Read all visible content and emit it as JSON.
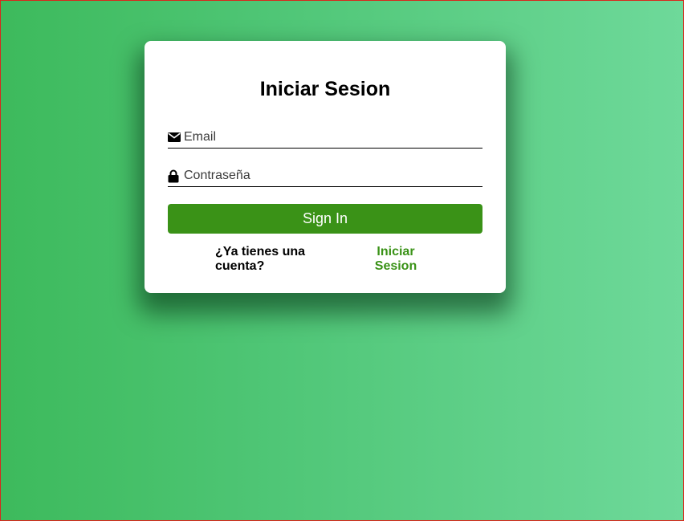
{
  "login": {
    "title": "Iniciar Sesion",
    "email_placeholder": "Email",
    "password_placeholder": "Contraseña",
    "submit_label": "Sign In",
    "account_prompt": "¿Ya tienes una cuenta?",
    "login_link_label": "Iniciar Sesion"
  },
  "icons": {
    "email": "envelope-icon",
    "password": "lock-icon"
  },
  "colors": {
    "accent": "#3a9217",
    "background_start": "#3dba5c",
    "background_end": "#6ed99a"
  }
}
